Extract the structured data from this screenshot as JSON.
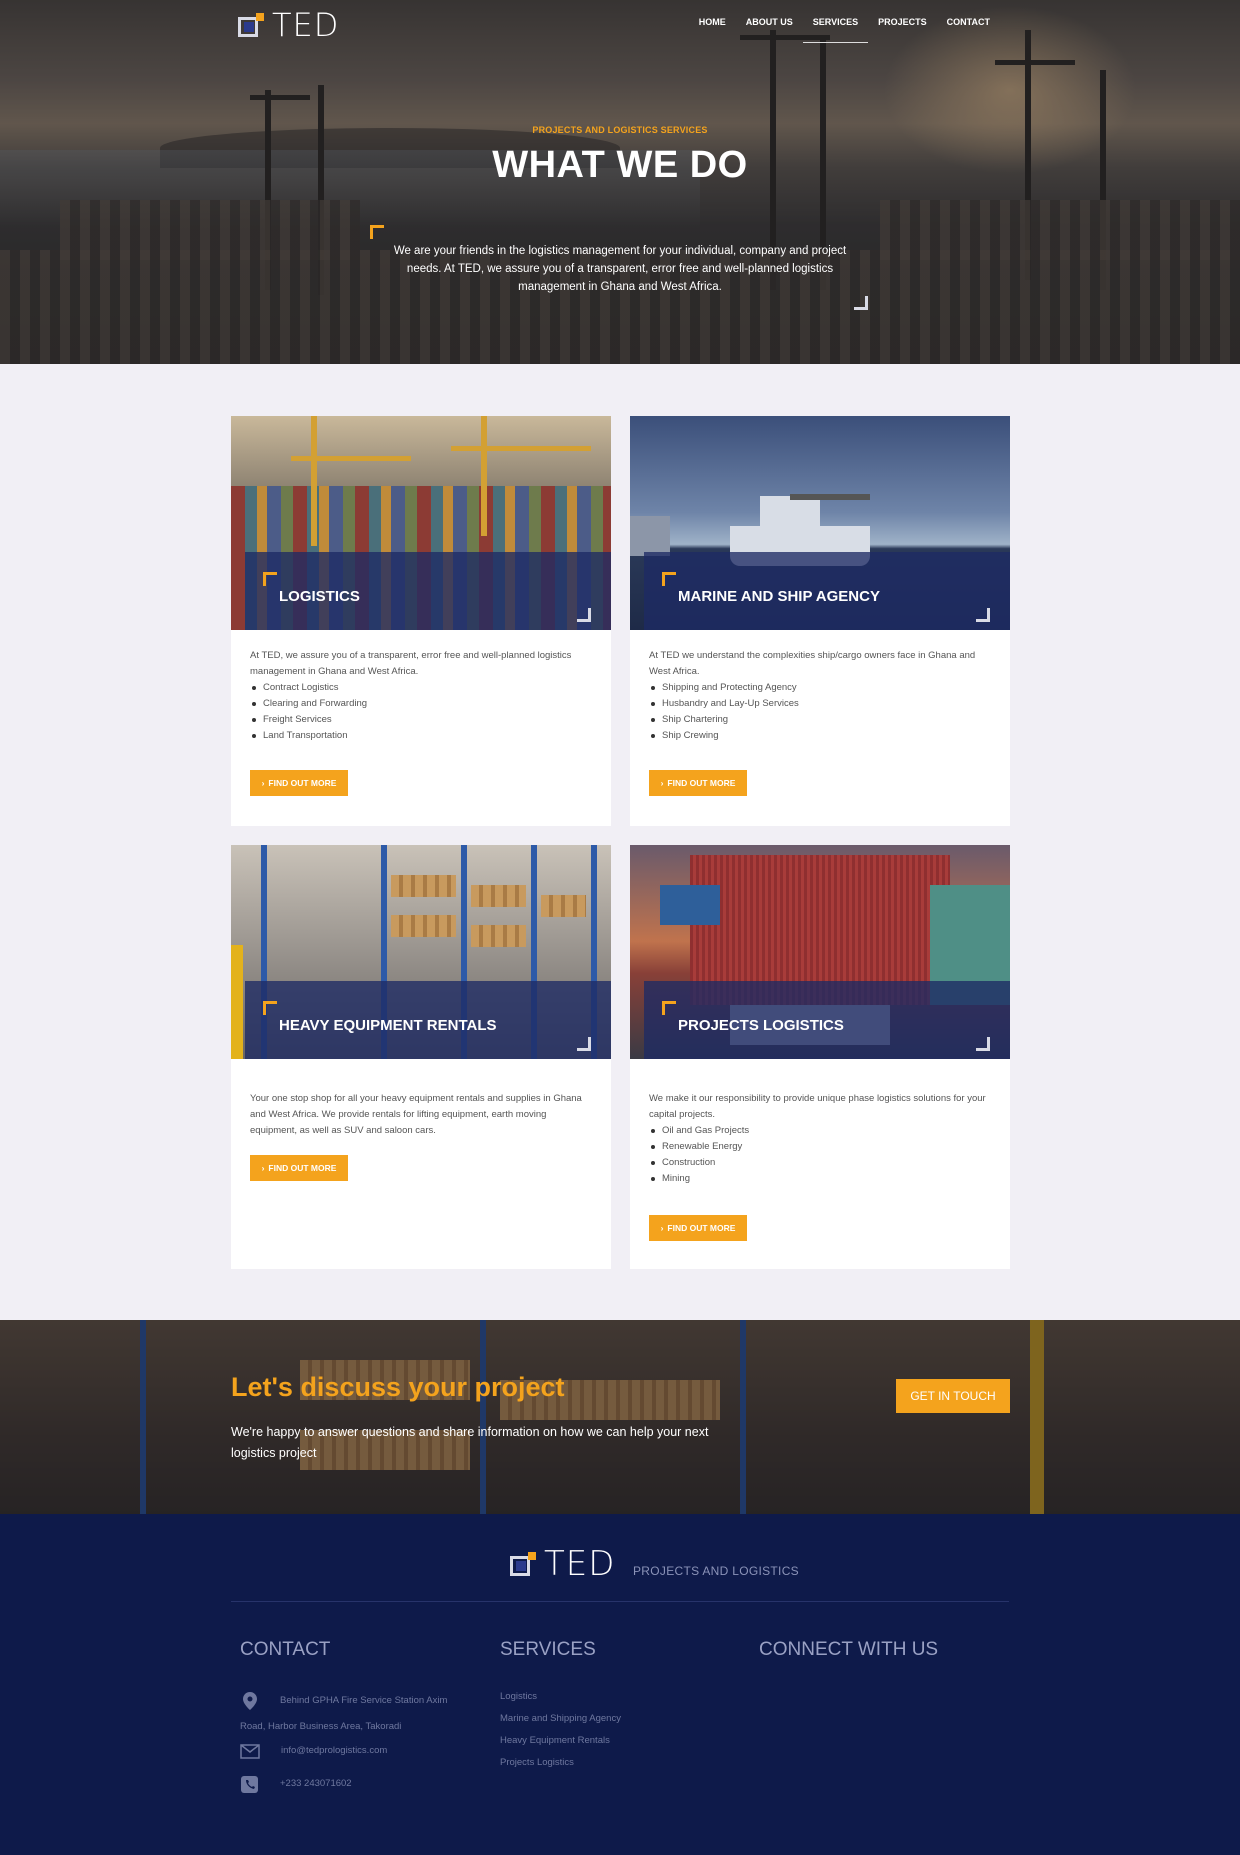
{
  "nav": {
    "logo_text": "TED",
    "items": [
      "HOME",
      "ABOUT US",
      "SERVICES",
      "PROJECTS",
      "CONTACT"
    ],
    "active_index": 2
  },
  "hero": {
    "subtitle": "PROJECTS AND LOGISTICS SERVICES",
    "title": "WHAT WE DO",
    "text": "We are your friends in the logistics management for your individual, company and project needs. At TED, we assure you of a transparent, error free and well-planned logistics management in Ghana and West Africa."
  },
  "services": [
    {
      "title": "LOGISTICS",
      "intro": "At TED, we assure you of a transparent, error free and well-planned logistics management in Ghana and West Africa.",
      "items": [
        "Contract Logistics",
        "Clearing and Forwarding",
        "Freight Services",
        "Land Transportation"
      ],
      "button": "FIND OUT MORE"
    },
    {
      "title": "MARINE AND SHIP AGENCY",
      "intro": "At TED we understand the complexities ship/cargo owners face in Ghana and West Africa.",
      "items": [
        "Shipping and Protecting Agency",
        "Husbandry and Lay-Up Services",
        "Ship Chartering",
        "Ship Crewing"
      ],
      "button": "FIND OUT MORE"
    },
    {
      "title": "HEAVY EQUIPMENT RENTALS",
      "intro": "Your one stop shop for all your heavy equipment rentals and supplies in Ghana and West Africa. We provide rentals for lifting equipment, earth moving equipment, as well as SUV and saloon cars.",
      "items": [],
      "button": "FIND OUT MORE"
    },
    {
      "title": "PROJECTS LOGISTICS",
      "intro": "We make it our responsibility to provide unique phase logistics solutions for your capital projects.",
      "items": [
        "Oil and Gas Projects",
        "Renewable Energy",
        "Construction",
        "Mining"
      ],
      "button": "FIND OUT MORE"
    }
  ],
  "cta": {
    "title": "Let's discuss your project",
    "text": "We're happy to answer questions and share information on how we can help your next logistics project",
    "button": "GET IN TOUCH"
  },
  "footer": {
    "logo_text": "TED",
    "tagline": "PROJECTS AND LOGISTICS",
    "contact_heading": "CONTACT",
    "address_line1": "Behind GPHA Fire Service Station Axim",
    "address_line2": "Road, Harbor Business Area, Takoradi",
    "email": "info@tedprologistics.com",
    "phone": "+233 243071602",
    "services_heading": "SERVICES",
    "service_links": [
      "Logistics",
      "Marine and Shipping Agency",
      "Heavy Equipment Rentals",
      "Projects Logistics"
    ],
    "connect_heading": "CONNECT WITH US"
  },
  "colors": {
    "accent": "#f4a31d",
    "navy": "#0e1a4a",
    "panel": "#1e2a64",
    "page_bg": "#f1eff5"
  }
}
